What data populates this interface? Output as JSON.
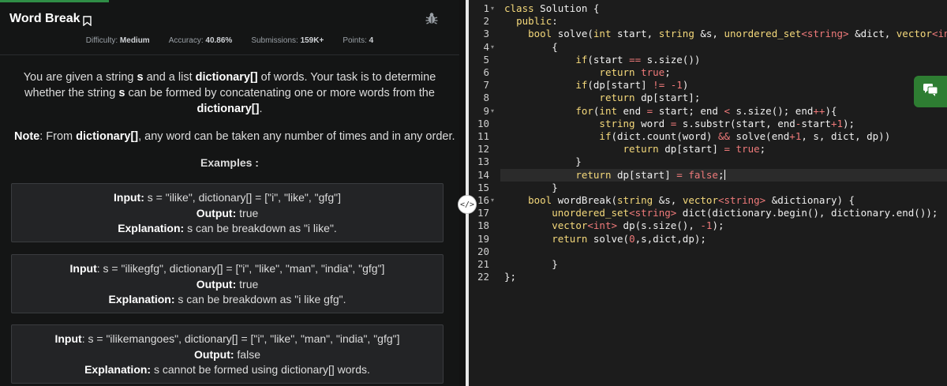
{
  "problem": {
    "title": "Word Break",
    "meta": {
      "difficulty_label": "Difficulty:",
      "difficulty_value": "Medium",
      "accuracy_label": "Accuracy:",
      "accuracy_value": "40.86%",
      "submissions_label": "Submissions:",
      "submissions_value": "159K+",
      "points_label": "Points:",
      "points_value": "4"
    },
    "desc": {
      "p1": "You are given a string ",
      "s": "s",
      "p2": " and a list ",
      "dict": "dictionary[]",
      "p3": " of words. Your task is to determine whether the string ",
      "s2": "s",
      "p4": " can be formed by concatenating one or more words from the ",
      "dict2": "dictionary[]",
      "p5": "."
    },
    "note": {
      "label": "Note",
      "p1": ": From ",
      "dict": "dictionary[]",
      "p2": ", any word can be taken any number of times and in any order."
    },
    "examples_title": "Examples :",
    "examples": [
      {
        "input_label": "Input:",
        "input_value": " s = \"ilike\", dictionary[] = [\"i\", \"like\", \"gfg\"]",
        "output_label": "Output:",
        "output_value": " true",
        "explanation_label": "Explanation:",
        "explanation_value": " s can be breakdown as \"i like\"."
      },
      {
        "input_label": "Input",
        "input_value": ": s = \"ilikegfg\", dictionary[] = [\"i\", \"like\", \"man\", \"india\", \"gfg\"]",
        "output_label": "Output:",
        "output_value": " true",
        "explanation_label": "Explanation:",
        "explanation_value": " s can be breakdown as \"i like gfg\"."
      },
      {
        "input_label": "Input",
        "input_value": ": s = \"ilikemangoes\", dictionary[] = [\"i\", \"like\", \"man\", \"india\", \"gfg\"]",
        "output_label": "Output:",
        "output_value": " false",
        "explanation_label": "Explanation:",
        "explanation_value": " s cannot be formed using dictionary[] words."
      }
    ]
  },
  "splitter": {
    "handle_glyph": "</>"
  },
  "editor": {
    "line_numbers": [
      "1",
      "2",
      "3",
      "4",
      "5",
      "6",
      "7",
      "8",
      "9",
      "10",
      "11",
      "12",
      "13",
      "14",
      "15",
      "16",
      "17",
      "18",
      "19",
      "20",
      "21",
      "22"
    ],
    "active_line": 14,
    "code": [
      "class Solution {",
      "  public:",
      "    bool solve(int start, string &s, unordered_set<string> &dict, vector<int> &dp){",
      "        {",
      "            if(start == s.size())",
      "                return true;",
      "            if(dp[start] != -1)",
      "                return dp[start];",
      "            for(int end = start; end < s.size(); end++){",
      "                string word = s.substr(start, end-start+1);",
      "                if(dict.count(word) && solve(end+1, s, dict, dp))",
      "                    return dp[start] = true;",
      "            }",
      "            return dp[start] = false;",
      "        }",
      "    bool wordBreak(string &s, vector<string> &dictionary) {",
      "        unordered_set<string> dict(dictionary.begin(), dictionary.end());",
      "        vector<int> dp(s.size(), -1);",
      "        return solve(0,s,dict,dp);",
      "",
      "        }",
      "};"
    ]
  },
  "colors": {
    "accent": "#2f8d46",
    "keyword": "#f5d97b",
    "operator": "#ef7a7a"
  },
  "icons": [
    "bookmark-icon",
    "bug-icon",
    "chat-icon",
    "split-handle-icon"
  ]
}
